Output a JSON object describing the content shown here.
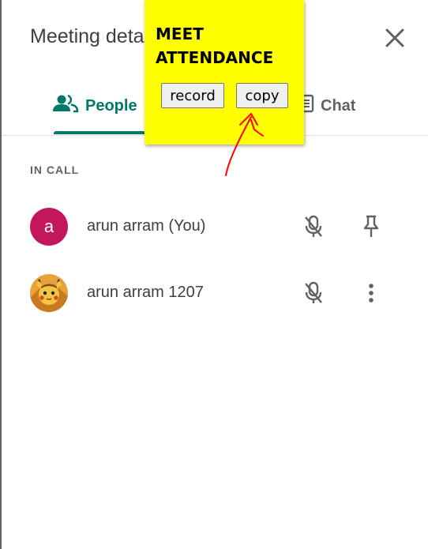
{
  "panel": {
    "title": "Meeting details",
    "close_icon": "close-icon"
  },
  "tabs": [
    {
      "label": "People",
      "icon": "people-icon",
      "active": true,
      "color": "#00796b"
    },
    {
      "label": "Chat",
      "icon": "chat-icon",
      "active": false,
      "color": "#5f6368"
    }
  ],
  "section": {
    "label": "IN CALL"
  },
  "participants": [
    {
      "name": "arun arram (You)",
      "avatar_letter": "a",
      "avatar_color": "#c2185b",
      "mic_icon": "mic-off-icon",
      "action_icon": "pin-icon"
    },
    {
      "name": "arun arram 1207",
      "avatar_letter": "",
      "avatar_color": "",
      "mic_icon": "mic-off-icon",
      "action_icon": "more-vert-icon"
    }
  ],
  "extension_popup": {
    "title": "MEET ATTENDANCE",
    "background": "#ffff00",
    "buttons": [
      {
        "label": "record"
      },
      {
        "label": "copy"
      }
    ],
    "annotation": {
      "icon": "red-arrow-icon",
      "color": "#ff0000"
    }
  }
}
